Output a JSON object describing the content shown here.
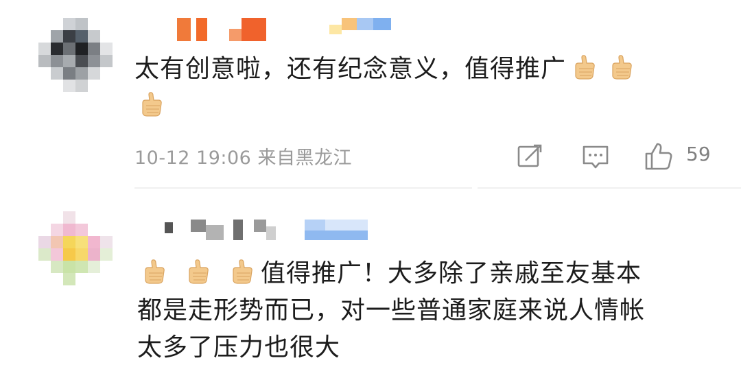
{
  "comments": [
    {
      "text": "太有创意啦，还有纪念意义，值得推广",
      "emoji_count": 3,
      "timestamp": "10-12 19:06",
      "location": "来自黑龙江",
      "likes": "59",
      "icons": [
        "repost-icon",
        "comment-icon",
        "like-icon"
      ]
    },
    {
      "text_line1": "值得推广！大多除了亲戚至友基本",
      "text_line2": "都是走形势而已，对一些普通家庭来说人情帐",
      "text_line3": "太多了压力也很大",
      "emoji_count": 3
    }
  ],
  "colors": {
    "meta_text": "#9a9a9a",
    "body_text": "#1c1c1c",
    "divider": "#f0f0f0"
  }
}
